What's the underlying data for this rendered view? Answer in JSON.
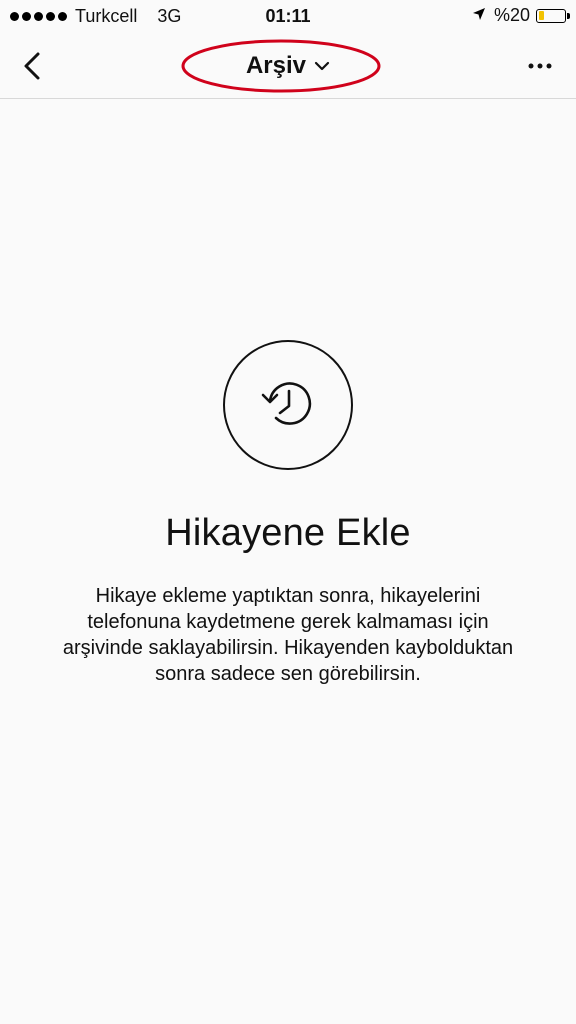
{
  "status_bar": {
    "carrier": "Turkcell",
    "network": "3G",
    "time": "01:11",
    "battery_text": "%20",
    "battery_level": 0.2,
    "battery_color": "#f2c200"
  },
  "nav": {
    "back_icon": "chevron-left-icon",
    "title": "Arşiv",
    "title_dropdown_icon": "chevron-down-icon",
    "more_icon": "more-horizontal-icon",
    "annotation_color": "#d0021b"
  },
  "empty_state": {
    "icon": "history-icon",
    "title": "Hikayene Ekle",
    "description": "Hikaye ekleme yaptıktan sonra, hikayelerini telefonuna kaydetmene gerek kalmaması için arşivinde saklayabilirsin. Hikayenden kaybolduktan sonra sadece sen görebilirsin."
  }
}
